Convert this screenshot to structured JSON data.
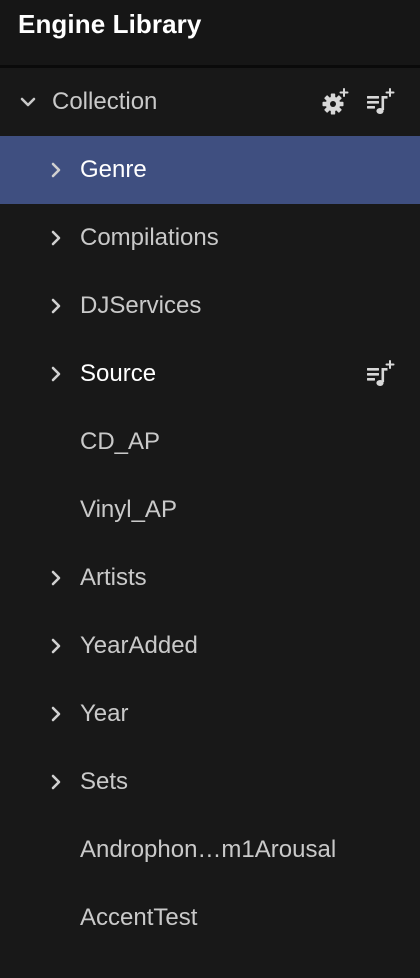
{
  "header": {
    "title": "Engine Library"
  },
  "collection": {
    "label": "Collection",
    "expanded": true,
    "actions": [
      {
        "icon": "gear-plus-icon"
      },
      {
        "icon": "add-playlist-icon"
      }
    ]
  },
  "items": [
    {
      "label": "Genre",
      "has_children": true,
      "expanded": false,
      "selected": true
    },
    {
      "label": "Compilations",
      "has_children": true,
      "expanded": false
    },
    {
      "label": "DJServices",
      "has_children": true,
      "expanded": false
    },
    {
      "label": "Source",
      "has_children": true,
      "expanded": false,
      "hovered": true,
      "action_icon": "add-playlist-icon"
    },
    {
      "label": "CD_AP",
      "has_children": false
    },
    {
      "label": "Vinyl_AP",
      "has_children": false
    },
    {
      "label": "Artists",
      "has_children": true,
      "expanded": false
    },
    {
      "label": "YearAdded",
      "has_children": true,
      "expanded": false
    },
    {
      "label": "Year",
      "has_children": true,
      "expanded": false
    },
    {
      "label": "Sets",
      "has_children": true,
      "expanded": false
    },
    {
      "label": "Androphon…m1Arousal",
      "has_children": false
    },
    {
      "label": "AccentTest",
      "has_children": false
    }
  ],
  "colors": {
    "background": "#181818",
    "selected_row": "#3f4f80",
    "text": "#c9c9c9",
    "text_bright": "#ffffff"
  }
}
